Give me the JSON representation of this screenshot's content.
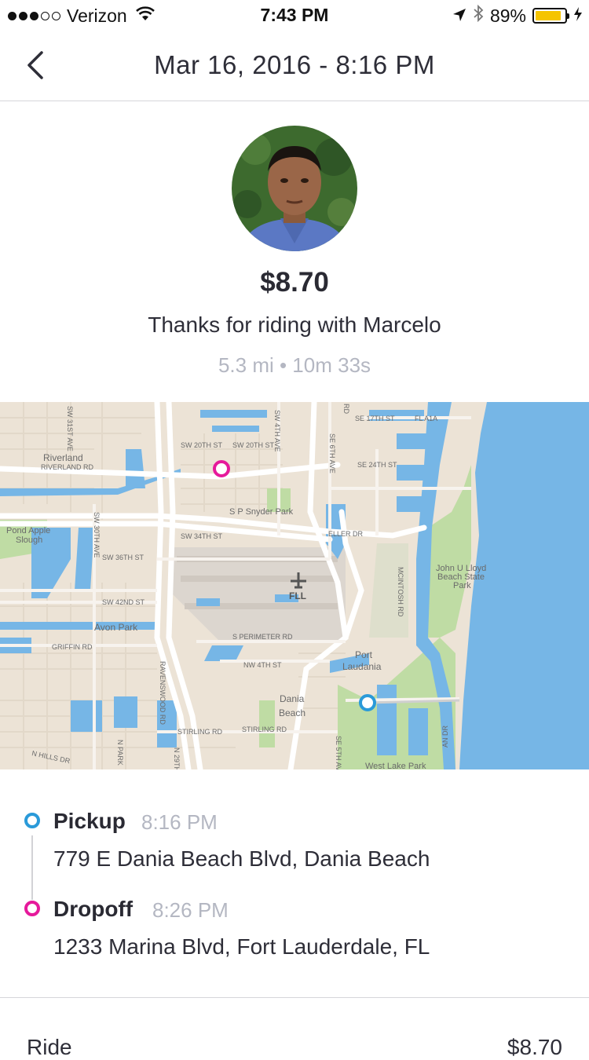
{
  "status_bar": {
    "carrier": "Verizon",
    "time": "7:43 PM",
    "battery": "89%",
    "battery_level": 0.89,
    "icons": [
      "signal-dots-icon",
      "wifi-icon",
      "location-arrow-icon",
      "bluetooth-icon",
      "battery-icon",
      "charging-bolt-icon"
    ]
  },
  "nav": {
    "title": "Mar 16, 2016 - 8:16 PM",
    "back_icon": "chevron-left-icon"
  },
  "summary": {
    "fare": "$8.70",
    "thanks": "Thanks for riding with Marcelo",
    "stats": "5.3 mi • 10m 33s"
  },
  "map": {
    "labels": {
      "riverland": "Riverland",
      "riverland_rd": "RIVERLAND RD",
      "pond_apple_1": "Pond Apple",
      "pond_apple_2": "Slough",
      "sw_36th": "SW 36TH ST",
      "sw_42nd": "SW 42ND ST",
      "avon_park": "Avon Park",
      "griffin_rd": "GRIFFIN RD",
      "n_hills": "N HILLS DR",
      "sw_20th_a": "SW 20TH ST",
      "sw_20th_b": "SW 20TH ST",
      "sw_34th": "SW 34TH ST",
      "sp_snyder": "S P Snyder Park",
      "fll": "FLL",
      "s_perimeter": "S PERIMETER RD",
      "nw_4th": "NW 4TH ST",
      "port_1": "Port",
      "port_2": "Laudania",
      "dania_1": "Dania",
      "dania_2": "Beach",
      "stirling_a": "STIRLING RD",
      "stirling_b": "STIRLING RD",
      "se_17th": "SE 17TH ST",
      "fl_a1a": "FL A1A",
      "se_24th": "SE 24TH ST",
      "eller_dr": "ELLER DR",
      "john_1": "John U Lloyd",
      "john_2": "Beach State",
      "john_3": "Park",
      "west_lake": "West Lake Park",
      "sw_31st": "SW 31ST AVE",
      "sw_30th": "SW 30TH AVE",
      "sw_4th": "SW 4TH AVE",
      "se_6th": "SE 6TH AVE",
      "mcintosh": "MCINTOSH RD",
      "ravenswood": "RAVENSWOOD RD",
      "n_park": "N PARK",
      "n_29th": "N 29TH A",
      "se_5th": "SE 5TH AV",
      "rd_label": "RD",
      "an_dr": "AN DR"
    },
    "pickup_color": "#2a9ad9",
    "dropoff_color": "#e6199b",
    "water_color": "#76b6e6",
    "land_color": "#ece3d6",
    "park_color": "#bfdca4"
  },
  "pickup": {
    "label": "Pickup",
    "time": "8:16 PM",
    "address": "779 E Dania Beach Blvd, Dania Beach",
    "color": "#2a9ad9"
  },
  "dropoff": {
    "label": "Dropoff",
    "time": "8:26 PM",
    "address": "1233 Marina Blvd, Fort Lauderdale, FL",
    "color": "#e6199b"
  },
  "fare_breakdown": {
    "ride_label": "Ride",
    "ride_amount": "$8.70"
  }
}
